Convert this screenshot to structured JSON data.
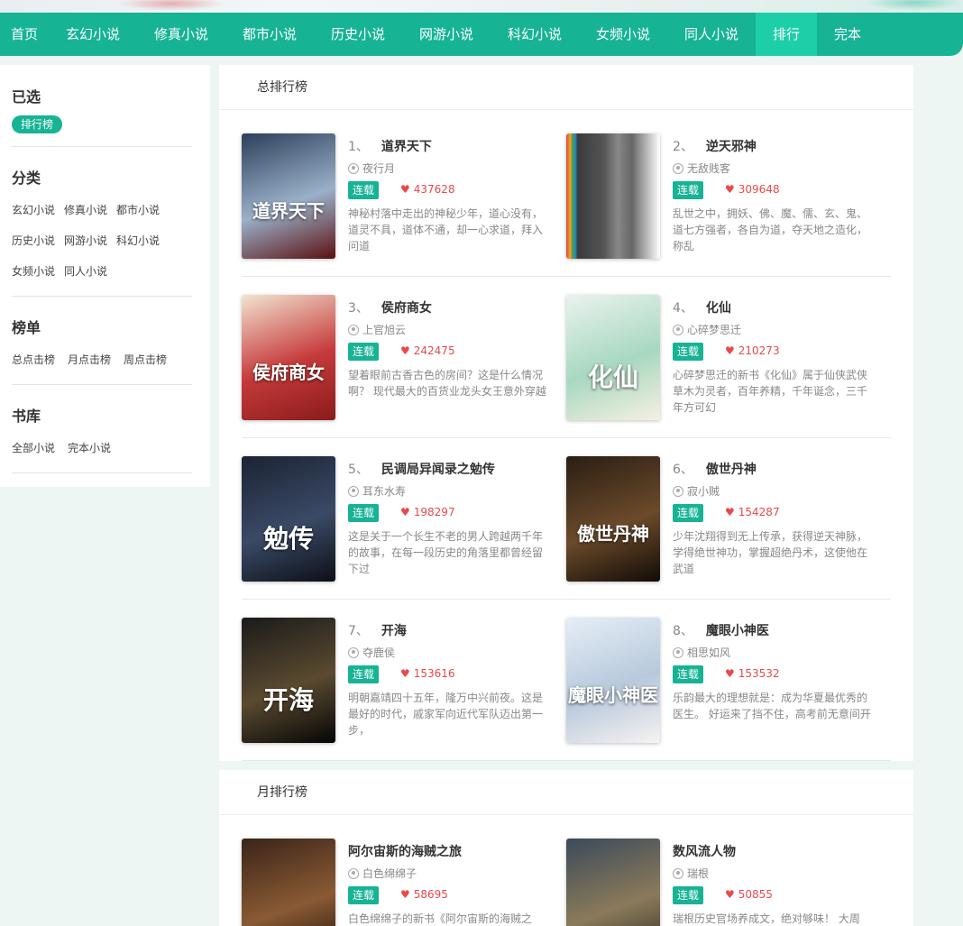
{
  "nav": {
    "items": [
      {
        "label": "首页",
        "active": false
      },
      {
        "label": "玄幻小说",
        "active": false
      },
      {
        "label": "修真小说",
        "active": false
      },
      {
        "label": "都市小说",
        "active": false
      },
      {
        "label": "历史小说",
        "active": false
      },
      {
        "label": "网游小说",
        "active": false
      },
      {
        "label": "科幻小说",
        "active": false
      },
      {
        "label": "女频小说",
        "active": false
      },
      {
        "label": "同人小说",
        "active": false
      },
      {
        "label": "排行",
        "active": true
      },
      {
        "label": "完本",
        "active": false
      }
    ]
  },
  "sidebar": {
    "selected": {
      "title": "已选",
      "chip": "排行榜"
    },
    "category": {
      "title": "分类",
      "rows": [
        [
          "玄幻小说",
          "修真小说",
          "都市小说"
        ],
        [
          "历史小说",
          "网游小说",
          "科幻小说"
        ],
        [
          "女频小说",
          "同人小说"
        ]
      ]
    },
    "ranking": {
      "title": "榜单",
      "links": [
        "总点击榜",
        "月点击榜",
        "周点击榜"
      ]
    },
    "library": {
      "title": "书库",
      "links": [
        "全部小说",
        "完本小说"
      ]
    }
  },
  "total_rank": {
    "title": "总排行榜",
    "books": [
      {
        "rank": "1、",
        "title": "道界天下",
        "author": "夜行月",
        "status": "连载",
        "likes": "437628",
        "desc": "神秘村落中走出的神秘少年，道心没有，道灵不具，道体不通，却一心求道，拜入问道",
        "cover_text": "道界天下",
        "cover_colors": [
          "#2c3f5a",
          "#9ab0c9",
          "#5a1010"
        ]
      },
      {
        "rank": "2、",
        "title": "逆天邪神",
        "author": "无敌贱客",
        "status": "连载",
        "likes": "309648",
        "desc": "乱世之中，拥妖、佛、魔、儒、玄、鬼、道七方强者，各自为道，夺天地之造化，称乱",
        "cover_text": "",
        "cover_colors": [
          "#ffffff",
          "#444444",
          "#777777"
        ]
      },
      {
        "rank": "3、",
        "title": "侯府商女",
        "author": "上官旭云",
        "status": "连载",
        "likes": "242475",
        "desc": "望着眼前古香古色的房间？这是什么情况啊？ 现代最大的百货业龙头女王意外穿越",
        "cover_text": "侯府商女",
        "cover_colors": [
          "#f2e4d0",
          "#c53a3a",
          "#8a1b1b"
        ]
      },
      {
        "rank": "4、",
        "title": "化仙",
        "author": "心碎梦思迁",
        "status": "连载",
        "likes": "210273",
        "desc": "心碎梦思迁的新书《化仙》属于仙侠武侠草木为灵者，百年养精，千年诞念，三千年方可幻",
        "cover_text": "化仙",
        "cover_colors": [
          "#e9f3ee",
          "#a8d8c0",
          "#f6f0e2"
        ]
      },
      {
        "rank": "5、",
        "title": "民调局异闻录之勉传",
        "author": "耳东水寿",
        "status": "连载",
        "likes": "198297",
        "desc": "这是关于一个长生不老的男人跨越两千年的故事，在每一段历史的角落里都曾经留下过",
        "cover_text": "勉传",
        "cover_colors": [
          "#1c2333",
          "#3a4a66",
          "#0c0f16"
        ]
      },
      {
        "rank": "6、",
        "title": "傲世丹神",
        "author": "寂小贼",
        "status": "连载",
        "likes": "154287",
        "desc": "少年沈翔得到无上传承，获得逆天神脉，学得绝世神功，掌握超绝丹术，这使他在武道",
        "cover_text": "傲世丹神",
        "cover_colors": [
          "#2a1e14",
          "#6b4a2a",
          "#120c08"
        ]
      },
      {
        "rank": "7、",
        "title": "开海",
        "author": "夺鹿侯",
        "status": "连载",
        "likes": "153616",
        "desc": "明朝嘉靖四十五年，隆万中兴前夜。这是最好的时代，戚家军向近代军队迈出第一步，",
        "cover_text": "开海",
        "cover_colors": [
          "#1a1a1a",
          "#5a4a30",
          "#050505"
        ]
      },
      {
        "rank": "8、",
        "title": "魔眼小神医",
        "author": "相思如风",
        "status": "连载",
        "likes": "153532",
        "desc": "乐韵最大的理想就是：成为华夏最优秀的医生。 好运来了挡不住，高考前无意间开",
        "cover_text": "魔眼小神医",
        "cover_colors": [
          "#e6eef6",
          "#b7c9dc",
          "#f7f2f2"
        ]
      }
    ]
  },
  "month_rank": {
    "title": "月排行榜",
    "books": [
      {
        "rank": "",
        "title": "阿尔宙斯的海贼之旅",
        "author": "白色绵绵子",
        "status": "连载",
        "likes": "58695",
        "desc": "白色绵绵子的新书《阿尔宙斯的海贼之",
        "cover_text": "",
        "cover_colors": [
          "#3a2418",
          "#8a5a34",
          "#1a0e08"
        ]
      },
      {
        "rank": "",
        "title": "数风流人物",
        "author": "瑞根",
        "status": "连载",
        "likes": "50855",
        "desc": "瑞根历史官场养成文，绝对够味！ 大周",
        "cover_text": "",
        "cover_colors": [
          "#3b4a5a",
          "#8a7a5a",
          "#2a2a20"
        ]
      }
    ]
  }
}
